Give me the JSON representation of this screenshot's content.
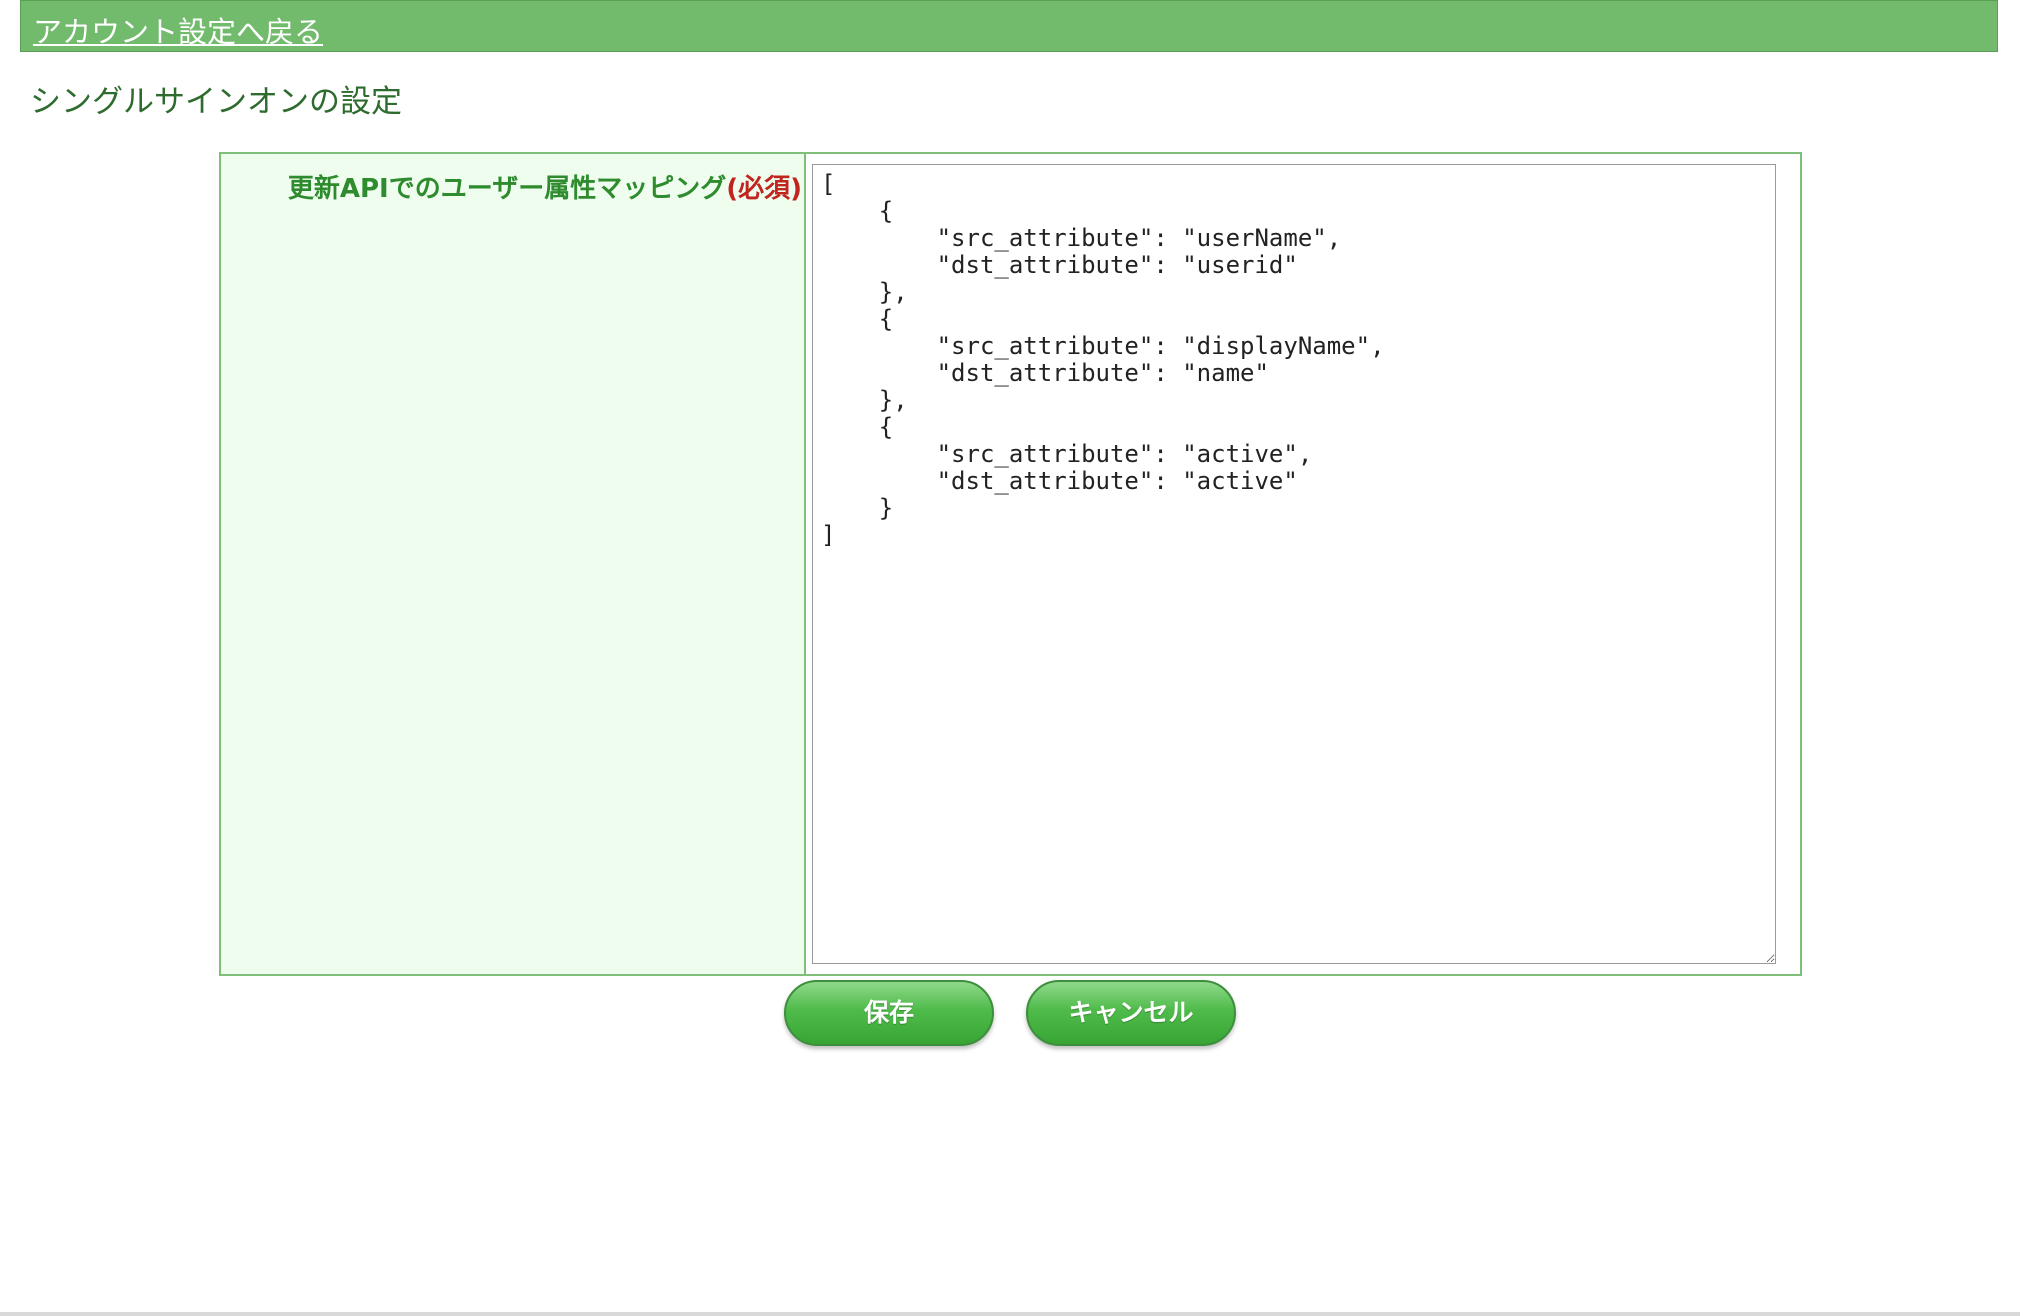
{
  "header": {
    "back_link": "アカウント設定へ戻る"
  },
  "page": {
    "title": "シングルサインオンの設定"
  },
  "form": {
    "field_label": "更新APIでのユーザー属性マッピング",
    "required_label": "(必須)",
    "mapping_value": "[\n    {\n        \"src_attribute\": \"userName\",\n        \"dst_attribute\": \"userid\"\n    },\n    {\n        \"src_attribute\": \"displayName\",\n        \"dst_attribute\": \"name\"\n    },\n    {\n        \"src_attribute\": \"active\",\n        \"dst_attribute\": \"active\"\n    }\n]"
  },
  "actions": {
    "save_label": "保存",
    "cancel_label": "キャンセル"
  },
  "colors": {
    "header_bar": "#72bb6d",
    "label_background": "#effdef",
    "label_text": "#2e8b2e",
    "required_text": "#c0251f",
    "button": "#4fbb4a"
  }
}
